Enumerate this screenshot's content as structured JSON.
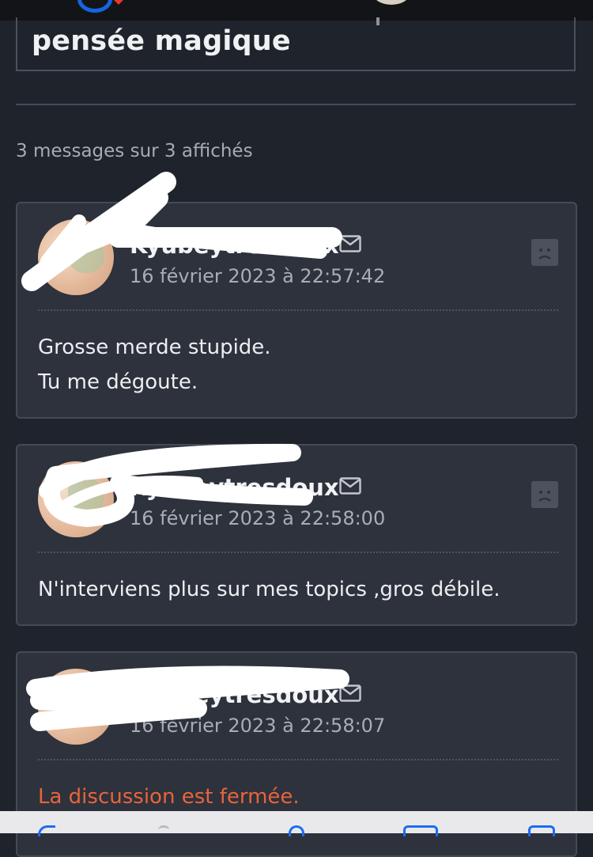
{
  "topic": {
    "title": "pensée magique",
    "message_count": "3 messages sur 3 affichés"
  },
  "posts": [
    {
      "username": "Kyubeytresdoux",
      "date": "16 février 2023 à 22:57:42",
      "lines": [
        "Grosse merde stupide.",
        "Tu me dégoute."
      ]
    },
    {
      "username": "Kyubeytresdoux",
      "date": "16 février 2023 à 22:58:00",
      "lines": [
        "N'interviens plus sur mes topics ,gros débile."
      ]
    },
    {
      "username": "Kyubeytresdoux",
      "date": "16 février 2023 à 22:58:07",
      "lines": [
        "La discussion est fermée."
      ]
    }
  ],
  "colors": {
    "background": "#1f232b",
    "card": "#2d323c",
    "closed_notice": "#e8643a",
    "toolbar_accent": "#1d6cf0"
  },
  "icons": [
    "mail-icon",
    "frown-icon",
    "share-icon",
    "bookmarks-icon",
    "tabs-icon",
    "back-icon",
    "forward-icon"
  ]
}
